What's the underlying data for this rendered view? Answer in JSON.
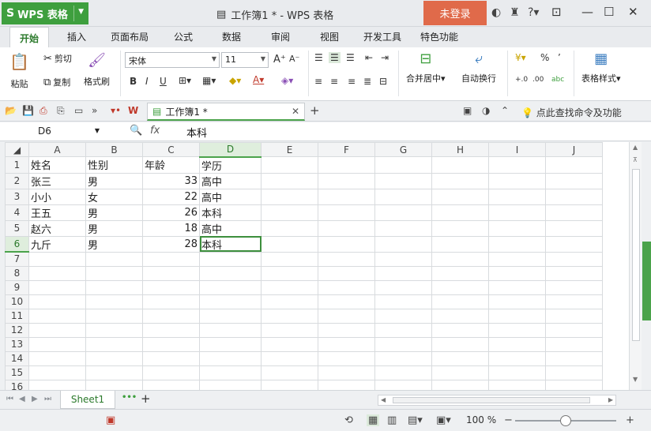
{
  "app": {
    "name": "WPS 表格",
    "logo": "S"
  },
  "window": {
    "title": "工作簿1 * - WPS 表格",
    "login_label": "未登录"
  },
  "ribbon_tabs": [
    "开始",
    "插入",
    "页面布局",
    "公式",
    "数据",
    "审阅",
    "视图",
    "开发工具",
    "特色功能"
  ],
  "ribbon": {
    "paste": "粘贴",
    "cut": "剪切",
    "copy": "复制",
    "format_painter": "格式刷",
    "font_name": "宋体",
    "font_size": "11",
    "merge_center": "合并居中",
    "wrap_text": "自动换行",
    "percent": "%",
    "comma": "’",
    "table_style": "表格样式",
    "bold": "B",
    "italic": "I",
    "underline": "U"
  },
  "doc_tab": {
    "label": "工作簿1 *"
  },
  "search_commands": "点此查找命令及功能",
  "formula_bar": {
    "cell_ref": "D6",
    "fx": "fx",
    "value": "本科"
  },
  "sheet": {
    "columns": [
      "A",
      "B",
      "C",
      "D",
      "E",
      "F",
      "G",
      "H",
      "I",
      "J"
    ],
    "rows": [
      [
        "1",
        "姓名",
        "性别",
        "年龄",
        "学历"
      ],
      [
        "2",
        "张三",
        "男",
        "33",
        "高中"
      ],
      [
        "3",
        "小小",
        "女",
        "22",
        "高中"
      ],
      [
        "4",
        "王五",
        "男",
        "26",
        "本科"
      ],
      [
        "5",
        "赵六",
        "男",
        "18",
        "高中"
      ],
      [
        "6",
        "九斤",
        "男",
        "28",
        "本科"
      ],
      [
        "7",
        "",
        "",
        "",
        ""
      ],
      [
        "8",
        "",
        "",
        "",
        ""
      ],
      [
        "9",
        "",
        "",
        "",
        ""
      ],
      [
        "10",
        "",
        "",
        "",
        ""
      ],
      [
        "11",
        "",
        "",
        "",
        ""
      ],
      [
        "12",
        "",
        "",
        "",
        ""
      ],
      [
        "13",
        "",
        "",
        "",
        ""
      ],
      [
        "14",
        "",
        "",
        "",
        ""
      ],
      [
        "15",
        "",
        "",
        "",
        ""
      ],
      [
        "16",
        "",
        "",
        "",
        ""
      ]
    ],
    "selected": {
      "column": "D",
      "row": "6"
    }
  },
  "sheet_tabs": {
    "active": "Sheet1",
    "more": "•••",
    "add": "+"
  },
  "status": {
    "zoom": "100 %",
    "zoom_minus": "−",
    "zoom_plus": "+",
    "zoom_level": 0.5
  },
  "colors": {
    "accent": "#4ba34b",
    "login": "#e06a4a",
    "app": "#3e9f3e"
  }
}
